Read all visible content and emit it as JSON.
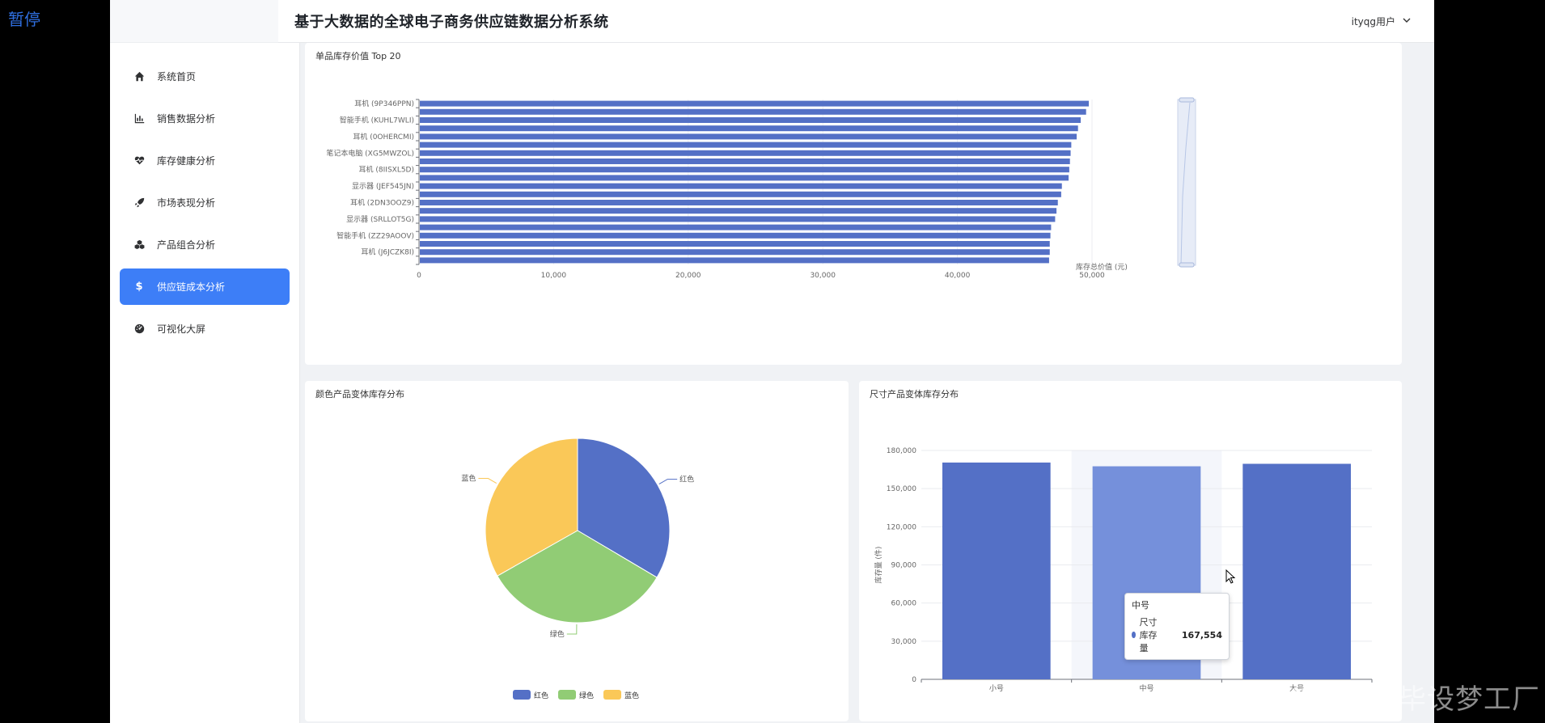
{
  "overlay": {
    "pause_label": "暂停",
    "watermark": "CSDN @IT毕设梦工厂"
  },
  "header": {
    "title": "基于大数据的全球电子商务供应链数据分析系统",
    "user": "ityqg用户"
  },
  "sidebar": {
    "items": [
      {
        "label": "系统首页",
        "icon": "home-icon",
        "active": false
      },
      {
        "label": "销售数据分析",
        "icon": "bar-chart-icon",
        "active": false
      },
      {
        "label": "库存健康分析",
        "icon": "heartbeat-icon",
        "active": false
      },
      {
        "label": "市场表现分析",
        "icon": "rocket-icon",
        "active": false
      },
      {
        "label": "产品组合分析",
        "icon": "cubes-icon",
        "active": false
      },
      {
        "label": "供应链成本分析",
        "icon": "dollar-icon",
        "active": true
      },
      {
        "label": "可视化大屏",
        "icon": "dashboard-icon",
        "active": false
      }
    ]
  },
  "colors": {
    "accent": "#3d7ef7",
    "bar": "#5470c6",
    "green": "#91cc75",
    "yellow": "#fac858"
  },
  "chart_data": [
    {
      "type": "bar",
      "orientation": "horizontal",
      "title": "单品库存价值 Top 20",
      "xlabel": "库存总价值 (元)",
      "xlim": [
        0,
        50000
      ],
      "xticks": [
        "0",
        "10,000",
        "20,000",
        "30,000",
        "40,000",
        "50,000"
      ],
      "categories": [
        "耳机 (9P346PPN)",
        "",
        "智能手机 (KUHL7WLI)",
        "",
        "耳机 (0OHERCMI)",
        "",
        "笔记本电脑 (XG5MWZOL)",
        "",
        "耳机 (8IISXL5D)",
        "",
        "显示器 (JEF545JN)",
        "",
        "耳机 (2DN3OOZ9)",
        "",
        "显示器 (SRLLOT5G)",
        "",
        "智能手机 (ZZ29AOOV)",
        "",
        "耳机 (J6JCZK8I)",
        ""
      ],
      "values": [
        49700,
        49500,
        49100,
        48900,
        48800,
        48400,
        48350,
        48300,
        48250,
        48200,
        47700,
        47650,
        47400,
        47300,
        47200,
        46900,
        46850,
        46800,
        46800,
        46750
      ],
      "datazoom": "vertical slider on right"
    },
    {
      "type": "pie",
      "title": "颜色产品变体库存分布",
      "slices": [
        {
          "name": "红色",
          "value": 33.5
        },
        {
          "name": "绿色",
          "value": 33.3
        },
        {
          "name": "蓝色",
          "value": 33.2
        }
      ],
      "legend": [
        "红色",
        "绿色",
        "蓝色"
      ],
      "legend_position": "bottom"
    },
    {
      "type": "bar",
      "title": "尺寸产品变体库存分布",
      "ylabel": "库存量 (件)",
      "ylim": [
        0,
        180000
      ],
      "yticks": [
        "0",
        "30,000",
        "60,000",
        "90,000",
        "120,000",
        "150,000",
        "180,000"
      ],
      "categories": [
        "小号",
        "中号",
        "大号"
      ],
      "values": [
        170500,
        167554,
        169500
      ],
      "highlighted": "中号"
    }
  ],
  "tooltip": {
    "title": "中号",
    "series": "尺寸库存量",
    "value": "167,554"
  }
}
